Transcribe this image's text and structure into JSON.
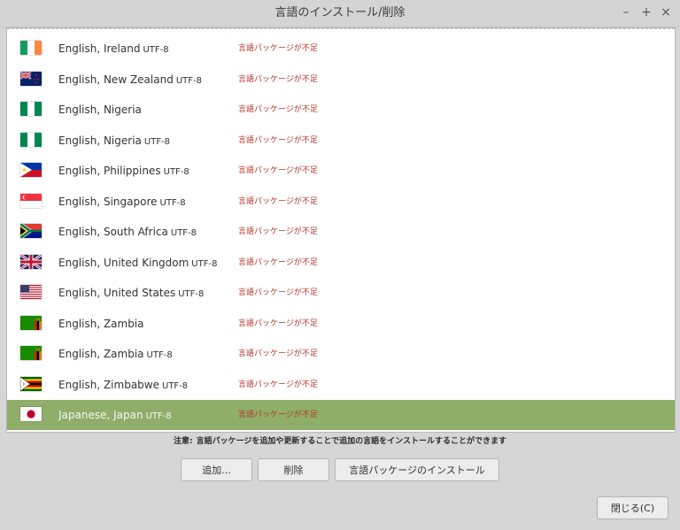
{
  "window": {
    "title": "言語のインストール/削除",
    "controls": {
      "minimize": "–",
      "maximize": "+",
      "close": "×"
    }
  },
  "languages": [
    {
      "name": "English, Ireland",
      "encoding": "UTF-8",
      "status": "言語パッケージが不足",
      "flag": "ireland-flag-icon"
    },
    {
      "name": "English, New Zealand",
      "encoding": "UTF-8",
      "status": "言語パッケージが不足",
      "flag": "new-zealand-flag-icon"
    },
    {
      "name": "English, Nigeria",
      "encoding": "",
      "status": "言語パッケージが不足",
      "flag": "nigeria-flag-icon"
    },
    {
      "name": "English, Nigeria",
      "encoding": "UTF-8",
      "status": "言語パッケージが不足",
      "flag": "nigeria-flag-icon"
    },
    {
      "name": "English, Philippines",
      "encoding": "UTF-8",
      "status": "言語パッケージが不足",
      "flag": "philippines-flag-icon"
    },
    {
      "name": "English, Singapore",
      "encoding": "UTF-8",
      "status": "言語パッケージが不足",
      "flag": "singapore-flag-icon"
    },
    {
      "name": "English, South Africa",
      "encoding": "UTF-8",
      "status": "言語パッケージが不足",
      "flag": "south-africa-flag-icon"
    },
    {
      "name": "English, United Kingdom",
      "encoding": "UTF-8",
      "status": "言語パッケージが不足",
      "flag": "united-kingdom-flag-icon"
    },
    {
      "name": "English, United States",
      "encoding": "UTF-8",
      "status": "言語パッケージが不足",
      "flag": "united-states-flag-icon"
    },
    {
      "name": "English, Zambia",
      "encoding": "",
      "status": "言語パッケージが不足",
      "flag": "zambia-flag-icon"
    },
    {
      "name": "English, Zambia",
      "encoding": "UTF-8",
      "status": "言語パッケージが不足",
      "flag": "zambia-flag-icon"
    },
    {
      "name": "English, Zimbabwe",
      "encoding": "UTF-8",
      "status": "言語パッケージが不足",
      "flag": "zimbabwe-flag-icon"
    },
    {
      "name": "Japanese, Japan",
      "encoding": "UTF-8",
      "status": "言語パッケージが不足",
      "flag": "japan-flag-icon",
      "selected": true
    }
  ],
  "note": {
    "label": "注意:",
    "text": "言語パッケージを追加や更新することで追加の言語をインストールすることができます"
  },
  "buttons": {
    "add": "追加...",
    "remove": "削除",
    "install": "言語パッケージのインストール",
    "close": "閉じる(C)"
  },
  "colors": {
    "selection": "#8fae6a",
    "status_text": "#b23a2e",
    "window_bg": "#d6d6d6"
  }
}
